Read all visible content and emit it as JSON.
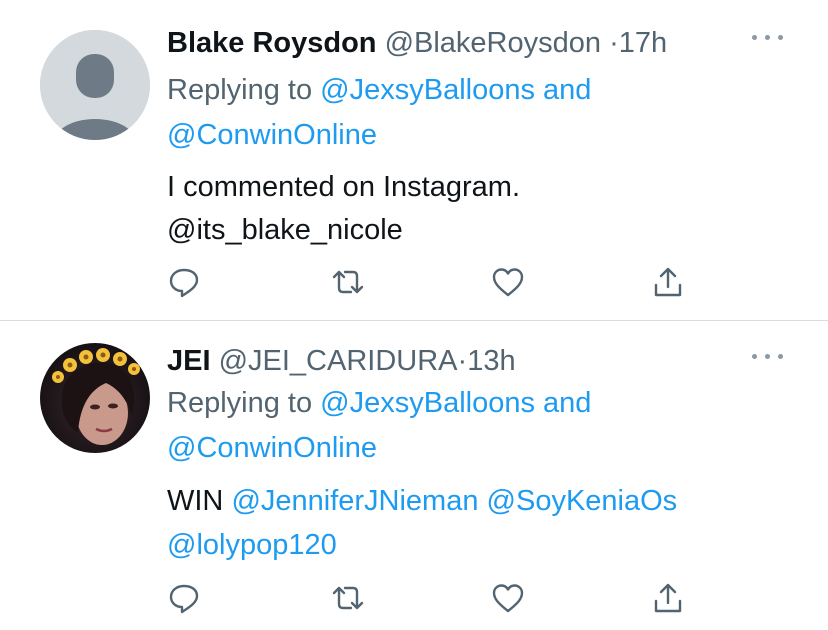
{
  "tweets": [
    {
      "display_name": "Blake Roysdon",
      "handle": "@BlakeRoysdon",
      "separator": "·",
      "time": "17h",
      "replying_prefix": "Replying to",
      "reply_to_1": "@JexsyBalloons",
      "reply_and": "and",
      "reply_to_2": "@ConwinOnline",
      "body_line_1": "I commented on Instagram.",
      "body_line_2": "@its_blake_nicole"
    },
    {
      "display_name": "JEI",
      "handle": "@JEI_CARIDURA",
      "separator": "·",
      "time": "13h",
      "replying_prefix": "Replying to",
      "reply_to_1": "@JexsyBalloons",
      "reply_and": "and",
      "reply_to_2": "@ConwinOnline",
      "body_prefix": "WIN",
      "mention_1": "@JenniferJNieman",
      "mention_2": "@SoyKeniaOs",
      "mention_3": "@lolypop120"
    }
  ],
  "icons": {
    "reply": "reply-icon",
    "retweet": "retweet-icon",
    "like": "heart-icon",
    "share": "share-icon",
    "more": "more-icon"
  },
  "colors": {
    "link": "#1d9bf0",
    "secondary_text": "#536471",
    "icon": "#536471",
    "divider": "#dcdcdc"
  }
}
